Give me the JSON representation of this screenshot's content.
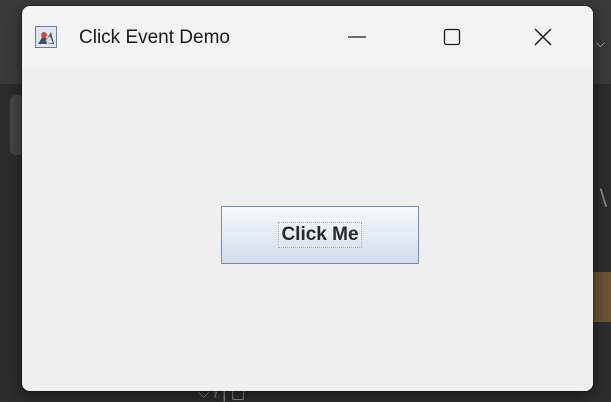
{
  "window": {
    "title": "Click Event Demo",
    "app_icon": "java-duke-icon",
    "controls": {
      "minimize": "minimize-icon",
      "maximize": "maximize-icon",
      "close": "close-icon"
    }
  },
  "content": {
    "button_label": "Click Me"
  },
  "colors": {
    "window_bg": "#efefef",
    "titlebar_bg": "#f3f3f3",
    "button_border": "#7a8ea8",
    "desktop_bg": "#2b2b2b"
  }
}
